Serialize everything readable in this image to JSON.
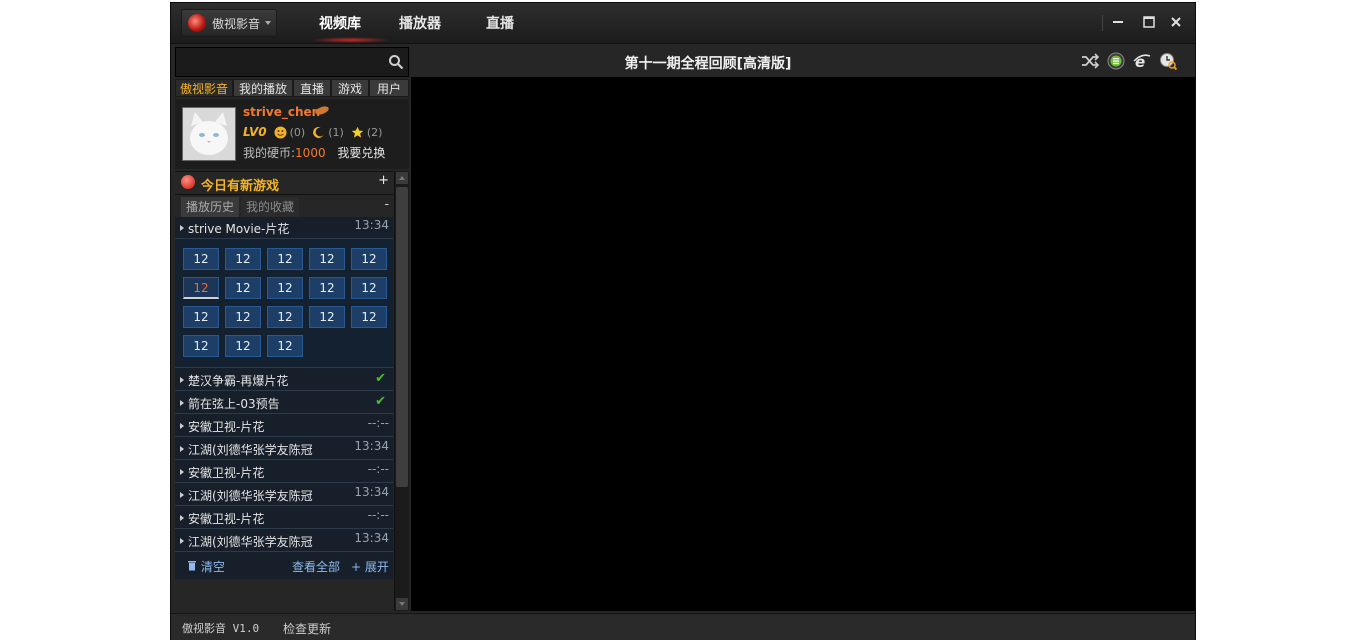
{
  "app": {
    "brand_label": "傲视影音",
    "nav_tabs": [
      "视频库",
      "播放器",
      "直播"
    ]
  },
  "search": {
    "value": "",
    "placeholder": ""
  },
  "left_tabs": [
    "傲视影音",
    "我的播放",
    "直播",
    "游戏",
    "用户"
  ],
  "profile": {
    "username": "strive_chen",
    "level": "LV0",
    "smile_count": "(0)",
    "moon_count": "(1)",
    "star_count": "(2)",
    "coins_label": "我的硬币:",
    "coins_value": "1000",
    "exchange_label": "我要兑换"
  },
  "today": {
    "label": "今日有新游戏",
    "toggle": "+"
  },
  "history_tabs": {
    "history": "播放历史",
    "favorites": "我的收藏",
    "toggle": "-"
  },
  "playlist": {
    "expanded_item": {
      "title": "strive Movie-片花",
      "time": "13:34"
    },
    "episodes": [
      "12",
      "12",
      "12",
      "12",
      "12",
      "12",
      "12",
      "12",
      "12",
      "12",
      "12",
      "12",
      "12",
      "12",
      "12",
      "12",
      "12",
      "12"
    ],
    "current_episode_index": 5,
    "items": [
      {
        "title": "楚汉争霸-再爆片花",
        "time": "",
        "status": "watched"
      },
      {
        "title": "箭在弦上-03预告",
        "time": "",
        "status": "watched"
      },
      {
        "title": "安徽卫视-片花",
        "time": "--:--",
        "status": ""
      },
      {
        "title": "江湖(刘德华张学友陈冠",
        "time": "13:34",
        "status": ""
      },
      {
        "title": "安徽卫视-片花",
        "time": "--:--",
        "status": ""
      },
      {
        "title": "江湖(刘德华张学友陈冠",
        "time": "13:34",
        "status": ""
      },
      {
        "title": "安徽卫视-片花",
        "time": "--:--",
        "status": ""
      },
      {
        "title": "江湖(刘德华张学友陈冠",
        "time": "13:34",
        "status": ""
      }
    ],
    "clear_label": "清空",
    "view_all_label": "查看全部",
    "expand_label": "+ 展开"
  },
  "video": {
    "title": "第十一期全程回顾[高清版]"
  },
  "statusbar": {
    "version": "傲视影音 V1.0",
    "check_update": "检查更新"
  },
  "colors": {
    "accent_orange": "#f07a2e",
    "accent_gold": "#f5b324",
    "link_blue": "#8db9f0",
    "episode_blue": "#1d3e66"
  },
  "icons": [
    "search-icon",
    "shuffle-icon",
    "playlist-icon",
    "ie-icon",
    "clock-search-icon",
    "trash-icon",
    "minimize-icon",
    "maximize-icon",
    "close-icon"
  ]
}
